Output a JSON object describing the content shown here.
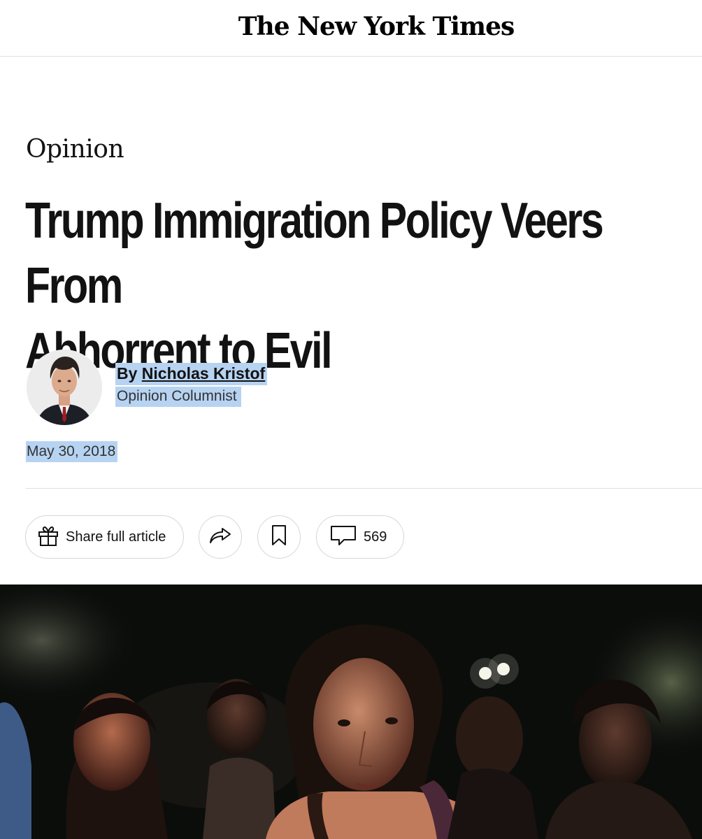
{
  "masthead": {
    "logo_text": "The New York Times"
  },
  "article": {
    "section": "Opinion",
    "headline_line1": "Trump Immigration Policy Veers From",
    "headline_line2": "Abhorrent to Evil",
    "byline_prefix": "By ",
    "author": "Nicholas Kristof",
    "author_role": "Opinion Columnist",
    "date": "May 30, 2018"
  },
  "actions": {
    "share_label": "Share full article",
    "share_icon": "gift-icon",
    "forward_icon": "share-arrow-icon",
    "save_icon": "bookmark-icon",
    "comments_icon": "comment-bubble-icon",
    "comments_count": "569"
  },
  "colors": {
    "text": "#121212",
    "selection_highlight": "#b7d3f2",
    "divider": "#dfdfdf",
    "button_border": "#d6d6d6"
  }
}
